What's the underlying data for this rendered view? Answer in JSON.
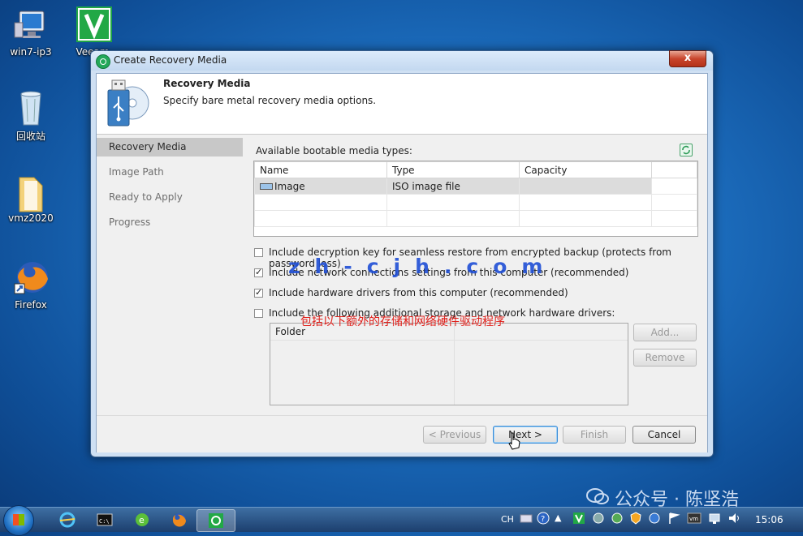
{
  "desktop": {
    "icons": [
      {
        "label": "win7-ip3"
      },
      {
        "label": "Veeam"
      },
      {
        "label": "回收站"
      },
      {
        "label": "vmz2020"
      },
      {
        "label": "Firefox"
      }
    ]
  },
  "dialog": {
    "title": "Create Recovery Media",
    "close_label": "x",
    "header": {
      "title": "Recovery Media",
      "subtitle": "Specify bare metal recovery media options."
    },
    "nav": [
      {
        "label": "Recovery Media",
        "active": true
      },
      {
        "label": "Image Path",
        "active": false
      },
      {
        "label": "Ready to Apply",
        "active": false
      },
      {
        "label": "Progress",
        "active": false
      }
    ],
    "main": {
      "media_types_label": "Available bootable media types:",
      "media_table": {
        "columns": [
          "Name",
          "Type",
          "Capacity"
        ],
        "rows": [
          {
            "name": "Image",
            "type": "ISO image file",
            "capacity": ""
          }
        ]
      },
      "options": [
        {
          "label": "Include decryption key for seamless restore from encrypted backup (protects from password loss)",
          "checked": false
        },
        {
          "label": "Include network connections settings from this computer (recommended)",
          "checked": true
        },
        {
          "label": "Include hardware drivers from this computer (recommended)",
          "checked": true
        },
        {
          "label": "Include the following additional storage and network hardware drivers:",
          "checked": false
        }
      ],
      "driver_table": {
        "columns": [
          "Folder"
        ]
      },
      "add_label": "Add...",
      "remove_label": "Remove",
      "annotation": "包括以下额外的存储和网络硬件驱动程序",
      "watermark_overlay": "zh-cjh.com"
    },
    "footer": {
      "previous_label": "< Previous",
      "next_label": "Next >",
      "finish_label": "Finish",
      "cancel_label": "Cancel"
    }
  },
  "watermark": "公众号 · 陈坚浩",
  "taskbar": {
    "tray": {
      "lang": "CH",
      "time": "15:06"
    }
  },
  "colors": {
    "accent": "#23a85a",
    "annotation": "#e0201b",
    "watermark_overlay": "#1f4fd6"
  }
}
